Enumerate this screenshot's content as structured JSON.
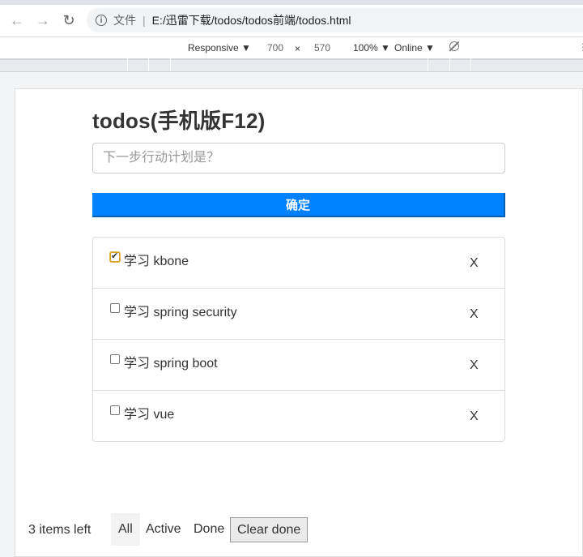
{
  "browser": {
    "file_label": "文件",
    "separator": "|",
    "url": "E:/迅雷下载/todos/todos前端/todos.html"
  },
  "devtools": {
    "device": "Responsive ▼",
    "width": "700",
    "times": "×",
    "height": "570",
    "zoom": "100% ▼",
    "network": "Online ▼"
  },
  "app": {
    "title": "todos(手机版F12)",
    "input_placeholder": "下一步行动计划是？",
    "confirm_label": "确定",
    "todos": [
      {
        "text": "学习 kbone",
        "done": true,
        "delete_label": "X"
      },
      {
        "text": "学习 spring security",
        "done": false,
        "delete_label": "X"
      },
      {
        "text": "学习 spring boot",
        "done": false,
        "delete_label": "X"
      },
      {
        "text": "学习 vue",
        "done": false,
        "delete_label": "X"
      }
    ],
    "footer": {
      "items_left": "3 items left",
      "filters": [
        "All",
        "Active",
        "Done"
      ],
      "active_filter": "All",
      "clear_label": "Clear done"
    }
  },
  "colors": {
    "confirm_button": "#0081ff",
    "confirm_text": "#ffffff"
  }
}
